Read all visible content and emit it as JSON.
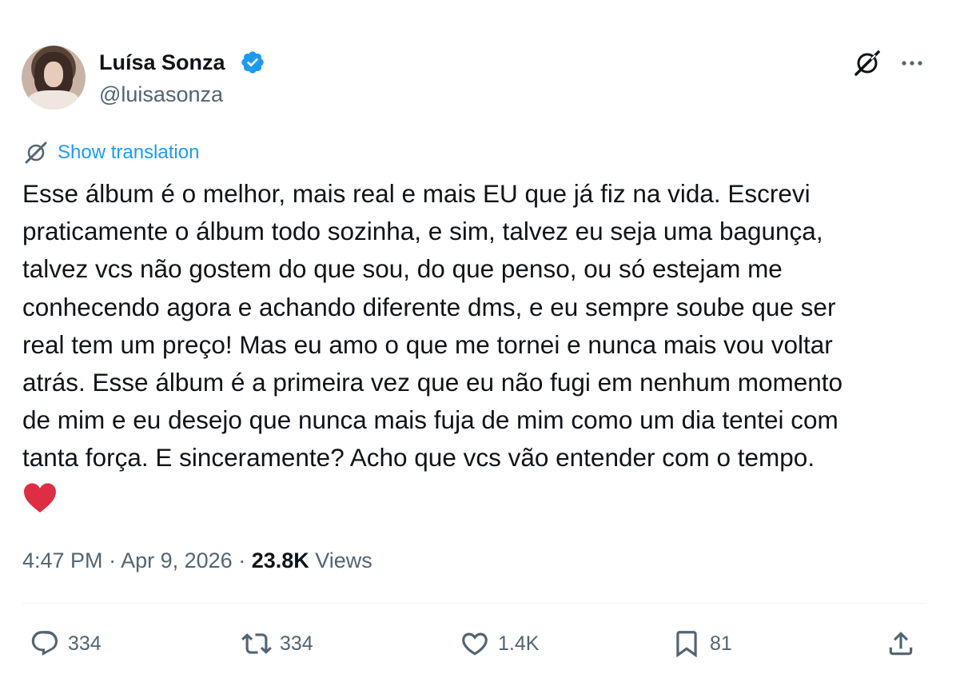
{
  "author": {
    "name": "Luísa Sonza",
    "handle": "@luisasonza",
    "verified": true,
    "avatar_icon": "profile-photo"
  },
  "header_actions": {
    "grok_icon": "grok-icon",
    "more_icon": "more-horizontal-icon"
  },
  "translation": {
    "icon": "translate-icon",
    "label": "Show translation"
  },
  "tweet": {
    "text": "Esse álbum é o melhor, mais real e mais EU que já fiz na vida. Escrevi\npraticamente o álbum todo sozinha, e sim, talvez eu seja uma bagunça,\ntalvez vcs não gostem do que sou, do que penso, ou só estejam me\nconhecendo agora e achando diferente dms, e eu sempre soube que ser\nreal tem um preço! Mas eu amo o que me tornei e nunca mais vou voltar\natrás. Esse álbum é a primeira vez que eu não fugi em nenhum momento\nde mim e eu desejo que nunca mais fuja de mim como um dia tentei com\ntanta força. E sinceramente? Acho que vcs vão entender com o tempo.",
    "emoji": "red-heart"
  },
  "meta": {
    "time": "4:47 PM",
    "separator": " · ",
    "date": "Apr 9, 2026",
    "views_count": "23.8K",
    "views_label": "Views"
  },
  "actions": {
    "replies": "334",
    "retweets": "334",
    "likes": "1.4K",
    "bookmarks": "81"
  },
  "colors": {
    "accent": "#1d9bf0",
    "secondary_text": "#536471",
    "primary_text": "#0f1419",
    "heart": "#e0245e"
  }
}
